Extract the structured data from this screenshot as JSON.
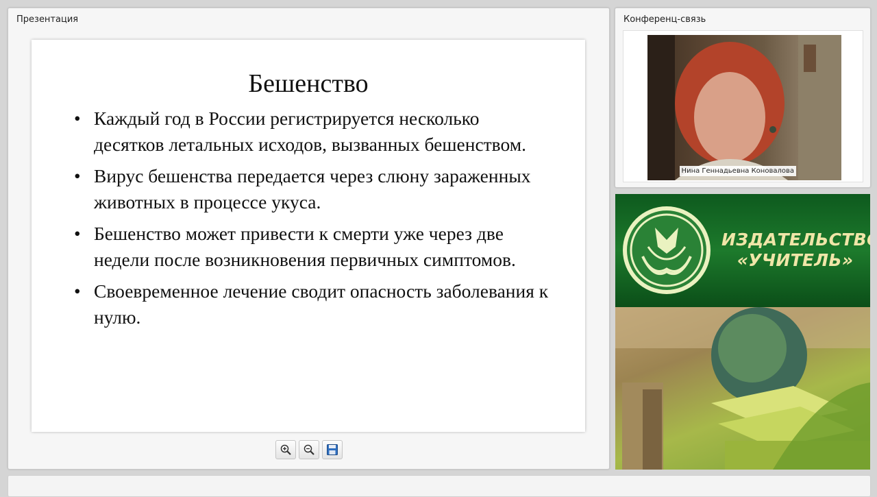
{
  "presentation": {
    "title": "Презентация",
    "slide": {
      "heading": "Бешенство",
      "bullets": [
        "Каждый год в России регистрируется несколько десятков летальных исходов, вызванных бешенством.",
        "Вирус бешенства передается через слюну зараженных животных в процессе укуса.",
        "Бешенство может привести к смерти уже через две недели после возникновения первичных симптомов.",
        "Своевременное лечение сводит опасность заболевания к нулю."
      ],
      "bullet_char": "•"
    },
    "toolbar": {
      "icons": [
        "zoom-in-icon",
        "zoom-out-icon",
        "save-icon"
      ]
    }
  },
  "conference": {
    "title": "Конференц-связь",
    "participant_name": "Нина Геннадьевна Коновалова"
  },
  "brand": {
    "line1": "ИЗДАТЕЛЬСТВО",
    "line2": "«УЧИТЕЛЬ»",
    "colors": {
      "green": "#1d7a2c",
      "gold": "#f0e6a8"
    }
  }
}
